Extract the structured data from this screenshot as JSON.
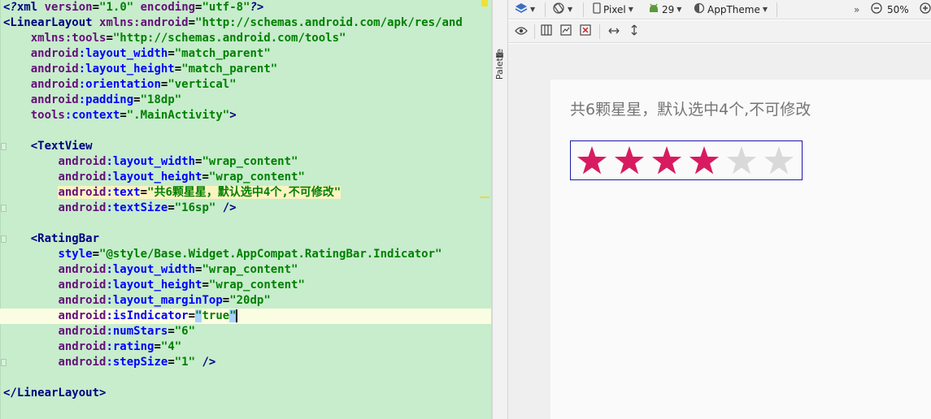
{
  "editor": {
    "lines": [
      [
        {
          "t": "pi",
          "v": "<?"
        },
        {
          "t": "tag",
          "v": "xml "
        },
        {
          "t": "ns",
          "v": "version"
        },
        {
          "t": "punc",
          "v": "="
        },
        {
          "t": "str",
          "v": "\"1.0\""
        },
        {
          "t": "ns",
          "v": " encoding"
        },
        {
          "t": "punc",
          "v": "="
        },
        {
          "t": "str",
          "v": "\"utf-8\""
        },
        {
          "t": "pi",
          "v": "?>"
        }
      ],
      [
        {
          "t": "tag",
          "v": "<LinearLayout "
        },
        {
          "t": "ns",
          "v": "xmlns:android"
        },
        {
          "t": "punc",
          "v": "="
        },
        {
          "t": "str",
          "v": "\"http://schemas.android.com/apk/res/and"
        }
      ],
      [
        {
          "t": "punc",
          "v": "    "
        },
        {
          "t": "ns",
          "v": "xmlns:tools"
        },
        {
          "t": "punc",
          "v": "="
        },
        {
          "t": "str",
          "v": "\"http://schemas.android.com/tools\""
        }
      ],
      [
        {
          "t": "punc",
          "v": "    "
        },
        {
          "t": "ns",
          "v": "android"
        },
        {
          "t": "attr",
          "v": ":layout_width"
        },
        {
          "t": "punc",
          "v": "="
        },
        {
          "t": "str",
          "v": "\"match_parent\""
        }
      ],
      [
        {
          "t": "punc",
          "v": "    "
        },
        {
          "t": "ns",
          "v": "android"
        },
        {
          "t": "attr",
          "v": ":layout_height"
        },
        {
          "t": "punc",
          "v": "="
        },
        {
          "t": "str",
          "v": "\"match_parent\""
        }
      ],
      [
        {
          "t": "punc",
          "v": "    "
        },
        {
          "t": "ns",
          "v": "android"
        },
        {
          "t": "attr",
          "v": ":orientation"
        },
        {
          "t": "punc",
          "v": "="
        },
        {
          "t": "str",
          "v": "\"vertical\""
        }
      ],
      [
        {
          "t": "punc",
          "v": "    "
        },
        {
          "t": "ns",
          "v": "android"
        },
        {
          "t": "attr",
          "v": ":padding"
        },
        {
          "t": "punc",
          "v": "="
        },
        {
          "t": "str",
          "v": "\"18dp\""
        }
      ],
      [
        {
          "t": "punc",
          "v": "    "
        },
        {
          "t": "ns",
          "v": "tools"
        },
        {
          "t": "attr",
          "v": ":context"
        },
        {
          "t": "punc",
          "v": "="
        },
        {
          "t": "str",
          "v": "\".MainActivity\""
        },
        {
          "t": "tag",
          "v": ">"
        }
      ],
      [],
      [
        {
          "t": "punc",
          "v": "    "
        },
        {
          "t": "tag",
          "v": "<TextView"
        }
      ],
      [
        {
          "t": "punc",
          "v": "        "
        },
        {
          "t": "ns",
          "v": "android"
        },
        {
          "t": "attr",
          "v": ":layout_width"
        },
        {
          "t": "punc",
          "v": "="
        },
        {
          "t": "str",
          "v": "\"wrap_content\""
        }
      ],
      [
        {
          "t": "punc",
          "v": "        "
        },
        {
          "t": "ns",
          "v": "android"
        },
        {
          "t": "attr",
          "v": ":layout_height"
        },
        {
          "t": "punc",
          "v": "="
        },
        {
          "t": "str",
          "v": "\"wrap_content\""
        }
      ],
      [
        {
          "t": "punc",
          "v": "        "
        },
        {
          "t": "ns",
          "v": "android",
          "hl": true
        },
        {
          "t": "attr",
          "v": ":text",
          "hl": true
        },
        {
          "t": "punc",
          "v": "=",
          "hl": true
        },
        {
          "t": "str",
          "v": "\"共6颗星星，默认选中4个,不可修改\"",
          "hl": true
        }
      ],
      [
        {
          "t": "punc",
          "v": "        "
        },
        {
          "t": "ns",
          "v": "android"
        },
        {
          "t": "attr",
          "v": ":textSize"
        },
        {
          "t": "punc",
          "v": "="
        },
        {
          "t": "str",
          "v": "\"16sp\""
        },
        {
          "t": "tag",
          "v": " />"
        }
      ],
      [],
      [
        {
          "t": "punc",
          "v": "    "
        },
        {
          "t": "tag",
          "v": "<RatingBar"
        }
      ],
      [
        {
          "t": "punc",
          "v": "        "
        },
        {
          "t": "attr",
          "v": "style"
        },
        {
          "t": "punc",
          "v": "="
        },
        {
          "t": "str",
          "v": "\"@style/Base.Widget.AppCompat.RatingBar.Indicator\""
        }
      ],
      [
        {
          "t": "punc",
          "v": "        "
        },
        {
          "t": "ns",
          "v": "android"
        },
        {
          "t": "attr",
          "v": ":layout_width"
        },
        {
          "t": "punc",
          "v": "="
        },
        {
          "t": "str",
          "v": "\"wrap_content\""
        }
      ],
      [
        {
          "t": "punc",
          "v": "        "
        },
        {
          "t": "ns",
          "v": "android"
        },
        {
          "t": "attr",
          "v": ":layout_height"
        },
        {
          "t": "punc",
          "v": "="
        },
        {
          "t": "str",
          "v": "\"wrap_content\""
        }
      ],
      [
        {
          "t": "punc",
          "v": "        "
        },
        {
          "t": "ns",
          "v": "android"
        },
        {
          "t": "attr",
          "v": ":layout_marginTop"
        },
        {
          "t": "punc",
          "v": "="
        },
        {
          "t": "str",
          "v": "\"20dp\""
        }
      ],
      [
        {
          "t": "punc",
          "v": "        "
        },
        {
          "t": "ns",
          "v": "android"
        },
        {
          "t": "attr",
          "v": ":isIndicator"
        },
        {
          "t": "punc",
          "v": "="
        },
        {
          "t": "sel",
          "v": "\""
        },
        {
          "t": "str",
          "v": "true"
        },
        {
          "t": "sel",
          "v": "\""
        },
        {
          "t": "caret",
          "v": ""
        }
      ],
      [
        {
          "t": "punc",
          "v": "        "
        },
        {
          "t": "ns",
          "v": "android"
        },
        {
          "t": "attr",
          "v": ":numStars"
        },
        {
          "t": "punc",
          "v": "="
        },
        {
          "t": "str",
          "v": "\"6\""
        }
      ],
      [
        {
          "t": "punc",
          "v": "        "
        },
        {
          "t": "ns",
          "v": "android"
        },
        {
          "t": "attr",
          "v": ":rating"
        },
        {
          "t": "punc",
          "v": "="
        },
        {
          "t": "str",
          "v": "\"4\""
        }
      ],
      [
        {
          "t": "punc",
          "v": "        "
        },
        {
          "t": "ns",
          "v": "android"
        },
        {
          "t": "attr",
          "v": ":stepSize"
        },
        {
          "t": "punc",
          "v": "="
        },
        {
          "t": "str",
          "v": "\"1\""
        },
        {
          "t": "tag",
          "v": " />"
        }
      ],
      [],
      [
        {
          "t": "tag",
          "v": "</LinearLayout>"
        }
      ]
    ],
    "current_line": 20,
    "fold_lines": [
      9,
      13,
      15,
      23
    ]
  },
  "palette": {
    "label": "Palette"
  },
  "toolbar": {
    "device": "Pixel",
    "api_level": "29",
    "theme": "AppTheme",
    "zoom": "50%",
    "overflow": "»"
  },
  "preview": {
    "text": "共6颗星星，默认选中4个,不可修改",
    "rating": {
      "num_stars": 6,
      "rating": 4,
      "filled_color": "#d81b60",
      "empty_color": "#d9d9d9"
    }
  },
  "colors": {
    "editor_bg": "#c7edcc",
    "current_line_bg": "#fbfde2"
  }
}
